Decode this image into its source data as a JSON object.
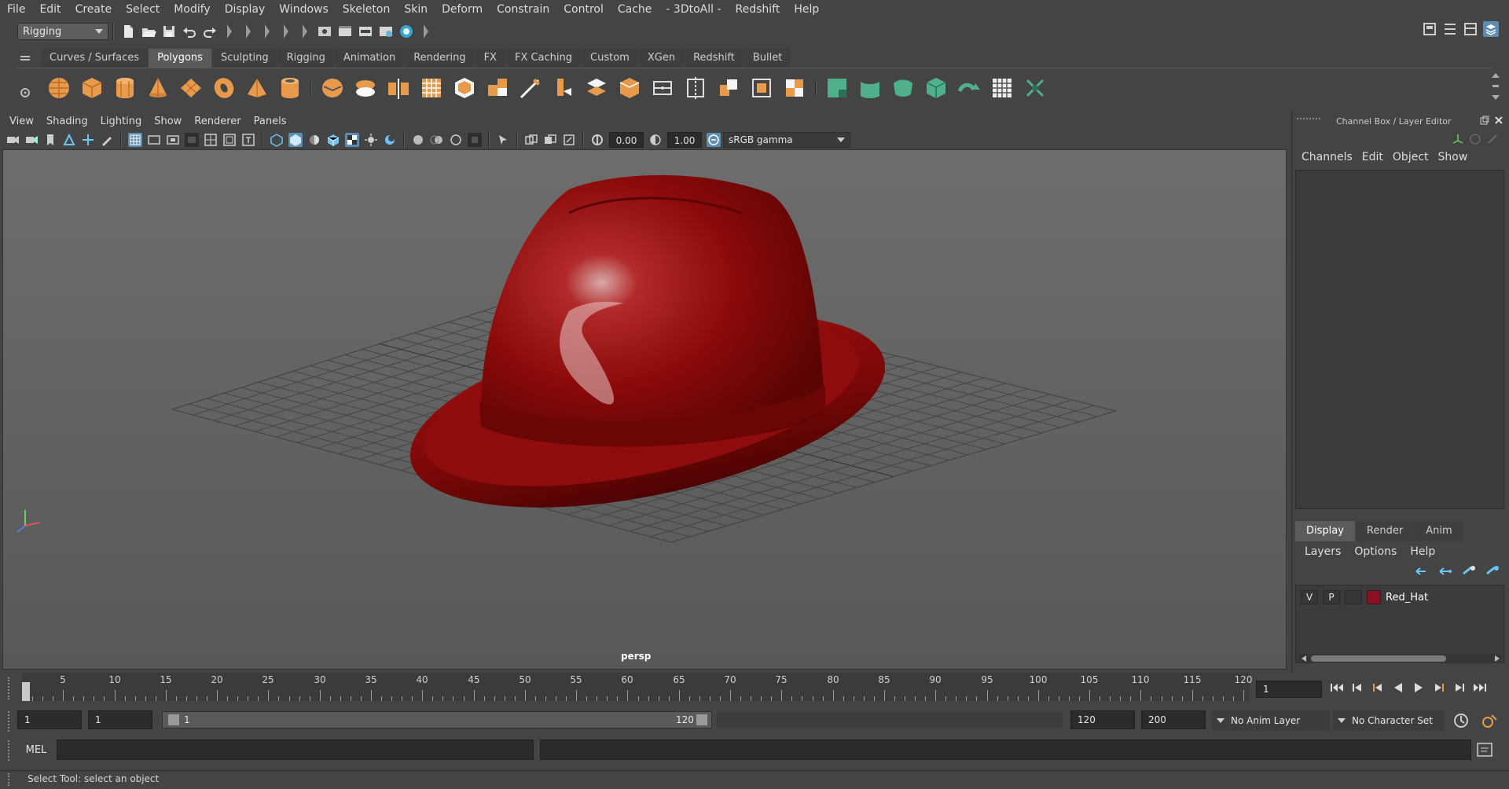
{
  "menubar": {
    "items": [
      "File",
      "Edit",
      "Create",
      "Select",
      "Modify",
      "Display",
      "Windows",
      "Skeleton",
      "Skin",
      "Deform",
      "Constrain",
      "Control",
      "Cache",
      "- 3DtoAll -",
      "Redshift",
      "Help"
    ]
  },
  "statusline": {
    "menuset": "Rigging"
  },
  "shelf": {
    "tabs": [
      "Curves / Surfaces",
      "Polygons",
      "Sculpting",
      "Rigging",
      "Animation",
      "Rendering",
      "FX",
      "FX Caching",
      "Custom",
      "XGen",
      "Redshift",
      "Bullet"
    ],
    "active_tab": "Polygons"
  },
  "viewport": {
    "menu": [
      "View",
      "Shading",
      "Lighting",
      "Show",
      "Renderer",
      "Panels"
    ],
    "exposure": "0.00",
    "gamma": "1.00",
    "color_space": "sRGB gamma",
    "camera": "persp",
    "object_color": "#8b0a0a"
  },
  "channelbox": {
    "title": "Channel Box / Layer Editor",
    "menu": [
      "Channels",
      "Edit",
      "Object",
      "Show"
    ]
  },
  "layereditor": {
    "tabs": [
      "Display",
      "Render",
      "Anim"
    ],
    "active_tab": "Display",
    "menu": [
      "Layers",
      "Options",
      "Help"
    ],
    "layers": [
      {
        "visible": "V",
        "playback": "P",
        "color": "#8f0f22",
        "name": "Red_Hat"
      }
    ]
  },
  "timeline": {
    "ticks": [
      "1",
      "5",
      "10",
      "15",
      "20",
      "25",
      "30",
      "35",
      "40",
      "45",
      "50",
      "55",
      "60",
      "65",
      "70",
      "75",
      "80",
      "85",
      "90",
      "95",
      "100",
      "105",
      "110",
      "115",
      "120"
    ],
    "current_frame": "1"
  },
  "range": {
    "start": "1",
    "playback_start": "1",
    "slider_start": "1",
    "slider_end": "120",
    "playback_end": "120",
    "end": "200",
    "anim_layer": "No Anim Layer",
    "character_set": "No Character Set"
  },
  "commandline": {
    "label": "MEL"
  },
  "helpline": {
    "text": "Select Tool: select an object"
  }
}
